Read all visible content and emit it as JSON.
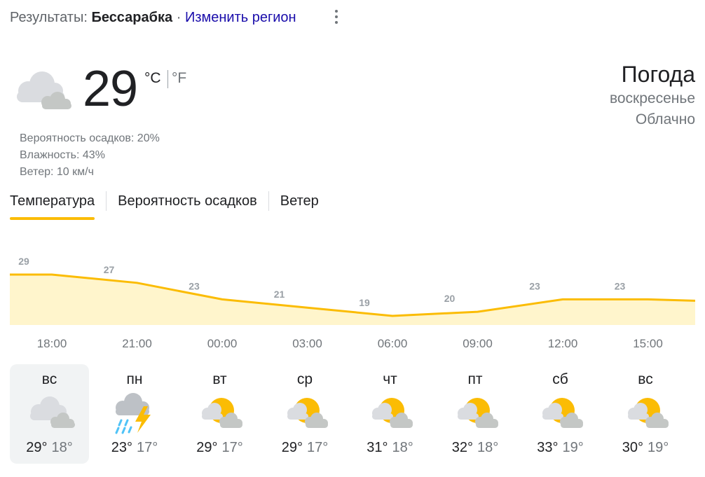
{
  "header": {
    "results_label": "Результаты:",
    "location": "Бессарабка",
    "separator": "·",
    "change_region": "Изменить регион"
  },
  "current": {
    "icon": "cloudy-icon",
    "temperature": "29",
    "unit_c": "°C",
    "unit_f": "°F",
    "precipitation": "Вероятность осадков: 20%",
    "humidity": "Влажность: 43%",
    "wind": "Ветер: 10 км/ч"
  },
  "heading": {
    "title": "Погода",
    "day": "воскресенье",
    "condition": "Облачно"
  },
  "tabs": [
    "Температура",
    "Вероятность осадков",
    "Ветер"
  ],
  "active_tab": 0,
  "colors": {
    "accent": "#fbbc04",
    "fill": "#fff5cc",
    "link": "#1a0dab"
  },
  "chart_data": {
    "type": "area",
    "x": [
      "18:00",
      "21:00",
      "00:00",
      "03:00",
      "06:00",
      "09:00",
      "12:00",
      "15:00"
    ],
    "values": [
      29,
      27,
      23,
      21,
      19,
      20,
      23,
      23
    ],
    "labels": [
      "29",
      "27",
      "23",
      "21",
      "19",
      "20",
      "23",
      "23"
    ]
  },
  "times": [
    "18:00",
    "21:00",
    "00:00",
    "03:00",
    "06:00",
    "09:00",
    "12:00",
    "15:00"
  ],
  "forecast": [
    {
      "day": "вс",
      "icon": "cloudy-icon",
      "hi": "29°",
      "lo": "18°"
    },
    {
      "day": "пн",
      "icon": "thunderstorm-icon",
      "hi": "23°",
      "lo": "17°"
    },
    {
      "day": "вт",
      "icon": "partly-cloudy-icon",
      "hi": "29°",
      "lo": "17°"
    },
    {
      "day": "ср",
      "icon": "partly-cloudy-icon",
      "hi": "29°",
      "lo": "17°"
    },
    {
      "day": "чт",
      "icon": "partly-cloudy-icon",
      "hi": "31°",
      "lo": "18°"
    },
    {
      "day": "пт",
      "icon": "partly-cloudy-icon",
      "hi": "32°",
      "lo": "18°"
    },
    {
      "day": "сб",
      "icon": "partly-cloudy-icon",
      "hi": "33°",
      "lo": "19°"
    },
    {
      "day": "вс",
      "icon": "partly-cloudy-icon",
      "hi": "30°",
      "lo": "19°"
    }
  ],
  "selected_day": 0
}
